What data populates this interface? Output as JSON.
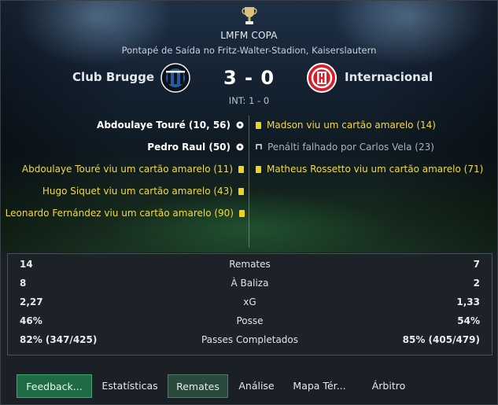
{
  "competition": {
    "title": "LMFM COPA",
    "icon": "trophy-icon"
  },
  "venue": "Pontapé de Saída no Fritz-Walter-Stadion, Kaiserslautern",
  "match": {
    "home_team": "Club Brugge",
    "away_team": "Internacional",
    "score": "3 - 0",
    "aggregate": "INT: 1 - 0",
    "home_crest": "club-brugge-crest",
    "away_crest": "internacional-crest"
  },
  "events": {
    "home": [
      {
        "text": "Abdoulaye Touré (10, 56)",
        "type": "goal",
        "icon": "ball-icon"
      },
      {
        "text": "Pedro Raul (50)",
        "type": "goal",
        "icon": "ball-icon"
      },
      {
        "text": "Abdoulaye Touré viu um cartão amarelo (11)",
        "type": "yellow",
        "icon": "yellow-card-icon"
      },
      {
        "text": "Hugo Siquet viu um cartão amarelo (43)",
        "type": "yellow",
        "icon": "yellow-card-icon"
      },
      {
        "text": "Leonardo Fernández viu um cartão amarelo (90)",
        "type": "yellow",
        "icon": "yellow-card-icon"
      }
    ],
    "away": [
      {
        "text": "Madson viu um cartão amarelo (14)",
        "type": "yellow",
        "icon": "yellow-card-icon"
      },
      {
        "text": "Penálti falhado por Carlos Vela (23)",
        "type": "missed-penalty",
        "icon": "missed-penalty-icon"
      },
      {
        "text": "Matheus Rossetto viu um cartão amarelo (71)",
        "type": "yellow",
        "icon": "yellow-card-icon"
      }
    ]
  },
  "stats": [
    {
      "label": "Remates",
      "home": "14",
      "away": "7"
    },
    {
      "label": "À Baliza",
      "home": "8",
      "away": "2"
    },
    {
      "label": "xG",
      "home": "2,27",
      "away": "1,33"
    },
    {
      "label": "Posse",
      "home": "46%",
      "away": "54%"
    },
    {
      "label": "Passes Completados",
      "home": "82% (347/425)",
      "away": "85% (405/479)"
    }
  ],
  "tabs": [
    {
      "label": "Feedback...",
      "state": "highlighted"
    },
    {
      "label": "Estatísticas",
      "state": "normal"
    },
    {
      "label": "Remates",
      "state": "selected"
    },
    {
      "label": "Análise",
      "state": "normal"
    },
    {
      "label": "Mapa Tér...",
      "state": "normal"
    },
    {
      "label": "Árbitro",
      "state": "normal"
    }
  ],
  "colors": {
    "yellow_text": "#f0d84a",
    "card_yellow": "#f2d21c",
    "accent_green": "#1f6b43",
    "internacional_red": "#d81e29",
    "brugge_blue": "#1c5fa8"
  }
}
